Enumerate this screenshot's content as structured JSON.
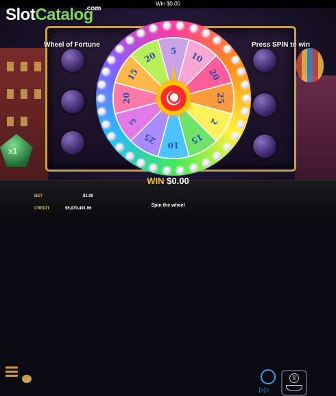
{
  "top_bar": {
    "win_text": "Win $0.00"
  },
  "logo": {
    "part1": "Slot",
    "part2": "Catalog",
    "suffix": ".com"
  },
  "overlay": {
    "left_title": "Wheel of Fortune",
    "right_title": "Press SPIN to win"
  },
  "side_badge": {
    "label": "x1"
  },
  "wheel": {
    "segments": [
      {
        "label": "5",
        "color": "#c9a2e8"
      },
      {
        "label": "10",
        "color": "#f7a6d6"
      },
      {
        "label": "20",
        "color": "#ff5c9c"
      },
      {
        "label": "25",
        "color": "#ff9a3c"
      },
      {
        "label": "2",
        "color": "#fff15a"
      },
      {
        "label": "15",
        "color": "#6fe36a"
      },
      {
        "label": "10",
        "color": "#4cc3ff"
      },
      {
        "label": "25",
        "color": "#a98bff"
      },
      {
        "label": "5",
        "color": "#e07ae8"
      },
      {
        "label": "20",
        "color": "#ff7aa8"
      },
      {
        "label": "15",
        "color": "#ffb84a"
      },
      {
        "label": "20",
        "color": "#b7ef5a"
      }
    ]
  },
  "bottom_bar": {
    "bet_label": "BET",
    "bet_value": "$1.00",
    "credit_label": "CREDIT",
    "credit_value": "$5,979,491.66",
    "win_label": "WIN",
    "win_value": "$0.00",
    "message": "Spin the wheel",
    "bet_button_symbol": "$"
  },
  "colors": {
    "accent_gold": "#f0c030",
    "accent_blue": "#3da0e0",
    "logo_green": "#7ed957"
  }
}
